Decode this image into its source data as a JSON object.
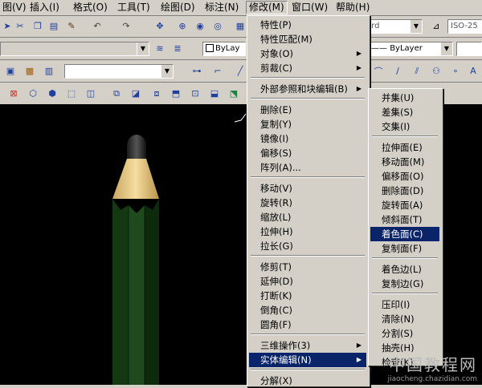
{
  "menubar": {
    "items": [
      "图(V)",
      "插入(I)",
      "格式(O)",
      "工具(T)",
      "绘图(D)",
      "标注(N)",
      "修改(M)",
      "窗口(W)",
      "帮助(H)"
    ]
  },
  "toolbar": {
    "textstyle_value": "ard",
    "dimstyle_value": "ISO-25",
    "layer_combo_value": "ByLay",
    "linetype_value": "ByLayer"
  },
  "modify_menu": {
    "items": [
      {
        "label": "特性(P)",
        "submenu": false
      },
      {
        "label": "特性匹配(M)",
        "submenu": false
      },
      {
        "label": "对象(O)",
        "submenu": true
      },
      {
        "label": "剪裁(C)",
        "submenu": true
      },
      {
        "label": "外部参照和块编辑(B)",
        "submenu": true
      },
      {
        "label": "删除(E)",
        "submenu": false
      },
      {
        "label": "复制(Y)",
        "submenu": false
      },
      {
        "label": "镜像(I)",
        "submenu": false
      },
      {
        "label": "偏移(S)",
        "submenu": false
      },
      {
        "label": "阵列(A)...",
        "submenu": false
      },
      {
        "label": "移动(V)",
        "submenu": false
      },
      {
        "label": "旋转(R)",
        "submenu": false
      },
      {
        "label": "缩放(L)",
        "submenu": false
      },
      {
        "label": "拉伸(H)",
        "submenu": false
      },
      {
        "label": "拉长(G)",
        "submenu": false
      },
      {
        "label": "修剪(T)",
        "submenu": false
      },
      {
        "label": "延伸(D)",
        "submenu": false
      },
      {
        "label": "打断(K)",
        "submenu": false
      },
      {
        "label": "倒角(C)",
        "submenu": false
      },
      {
        "label": "圆角(F)",
        "submenu": false
      },
      {
        "label": "三维操作(3)",
        "submenu": true
      },
      {
        "label": "实体编辑(N)",
        "submenu": true
      },
      {
        "label": "分解(X)",
        "submenu": false
      }
    ],
    "highlighted": "实体编辑(N)"
  },
  "solid_edit_menu": {
    "items": [
      "并集(U)",
      "差集(S)",
      "交集(I)",
      "拉伸面(E)",
      "移动面(M)",
      "偏移面(O)",
      "删除面(D)",
      "旋转面(A)",
      "倾斜面(T)",
      "着色面(C)",
      "复制面(F)",
      "着色边(L)",
      "复制边(G)",
      "压印(I)",
      "清除(N)",
      "分割(S)",
      "抽壳(H)",
      "检查(K)"
    ],
    "highlighted": "着色面(C)"
  },
  "watermark": {
    "line1": "中国教程网",
    "line2": "jiaocheng.chazidian.com"
  }
}
